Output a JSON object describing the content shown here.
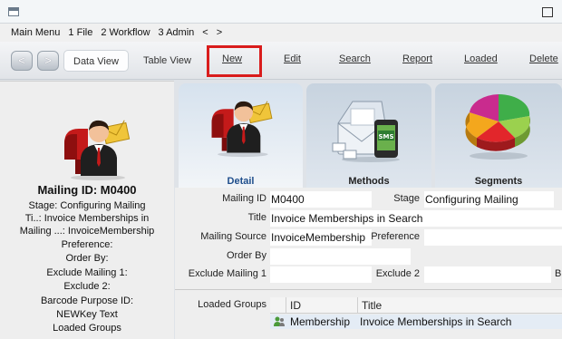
{
  "menubar": {
    "items": [
      "Main Menu",
      "1 File",
      "2 Workflow",
      "3 Admin",
      "<",
      ">"
    ]
  },
  "toolbar": {
    "back_label": "<",
    "forward_label": ">",
    "data_view": "Data View",
    "table_view": "Table View",
    "new": "New",
    "edit": "Edit",
    "search": "Search",
    "report": "Report",
    "loaded": "Loaded",
    "delete": "Delete",
    "highlight_color": "#d91c1c"
  },
  "left_panel": {
    "icon": "mailbox-person-icon",
    "title": "Mailing ID: M0400",
    "lines": [
      "Stage: Configuring Mailing",
      "Ti..: Invoice Memberships in",
      "Mailing ...: InvoiceMembership",
      "Preference:",
      "Order By:",
      "Exclude Mailing 1:",
      "Exclude 2:",
      "Barcode Purpose ID:",
      "NEWKey  Text",
      "Loaded Groups"
    ]
  },
  "tabs": [
    {
      "label": "Detail",
      "icon": "mailbox-person-icon",
      "active": true
    },
    {
      "label": "Methods",
      "icon": "mail-phone-sms-icon",
      "active": false
    },
    {
      "label": "Segments",
      "icon": "pie-chart-icon",
      "active": false
    }
  ],
  "form": {
    "mailing_id_label": "Mailing ID",
    "mailing_id_value": "M0400",
    "stage_label": "Stage",
    "stage_value": "Configuring Mailing",
    "title_label": "Title",
    "title_value": "Invoice Memberships in Search",
    "mailing_source_label": "Mailing Source",
    "mailing_source_value": "InvoiceMembership",
    "preference_label": "Preference",
    "preference_value": "",
    "order_by_label": "Order By",
    "order_by_value": "",
    "exclude1_label": "Exclude Mailing 1",
    "exclude1_value": "",
    "exclude2_label": "Exclude 2",
    "exclude2_value": "",
    "cut_label": "B"
  },
  "loaded_groups": {
    "label": "Loaded Groups",
    "columns": [
      "ID",
      "Title"
    ],
    "rows": [
      {
        "icon": "group-icon",
        "id": "Membership",
        "title": "Invoice Memberships in Search"
      }
    ]
  }
}
